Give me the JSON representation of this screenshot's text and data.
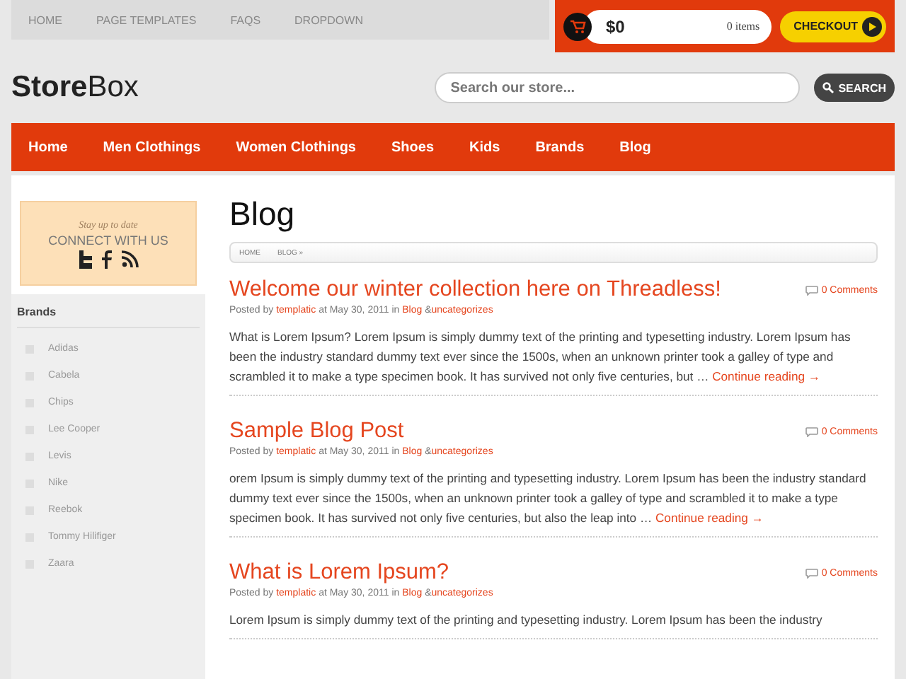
{
  "top_menu": [
    "HOME",
    "PAGE TEMPLATES",
    "FAQS",
    "DROPDOWN"
  ],
  "cart": {
    "total": "$0",
    "items": "0 items",
    "checkout": "CHECKOUT"
  },
  "logo": "**Store**Box",
  "search": {
    "placeholder": "Search our store...",
    "button": "SEARCH"
  },
  "nav": [
    "Home",
    "Men Clothings",
    "Women Clothings",
    "Shoes",
    "Kids",
    "Brands",
    "Blog"
  ],
  "connect": {
    "tagline": "Stay up to date",
    "title": "CONNECT WITH US"
  },
  "brands": {
    "title": "Brands",
    "items": [
      "Adidas",
      "Cabela",
      "Chips",
      "Lee Cooper",
      "Levis",
      "Nike",
      "Reebok",
      "Tommy Hilifiger",
      "Zaara"
    ]
  },
  "page_title": "Blog",
  "breadcrumb": [
    "HOME",
    "BLOG »"
  ],
  "posts": [
    {
      "title": "Welcome our winter collection here on Threadless!",
      "comments": "0 Comments",
      "by": "Posted by",
      "author": "templatic",
      "date": "at May 30, 2011 in",
      "category": "Blog",
      "amp": "&",
      "tag": "uncategorizes",
      "excerpt": "What is Lorem Ipsum? Lorem Ipsum is simply dummy text of the printing and typesetting industry. Lorem Ipsum has been the industry standard dummy text ever since the 1500s, when an unknown printer took a galley of type and scrambled it to make a type specimen book. It has survived not only five centuries, but …",
      "more": "Continue reading →"
    },
    {
      "title": "Sample Blog Post",
      "comments": "0 Comments",
      "by": "Posted by",
      "author": "templatic",
      "date": "at May 30, 2011 in",
      "category": "Blog",
      "amp": "&",
      "tag": "uncategorizes",
      "excerpt": "orem Ipsum is simply dummy text of the printing and typesetting industry. Lorem Ipsum has been the industry standard dummy text ever since the 1500s, when an unknown printer took a galley of type and scrambled it to make a type specimen book. It has survived not only five centuries, but also the leap into …",
      "more": "Continue reading →"
    },
    {
      "title": "What is Lorem Ipsum?",
      "comments": "0 Comments",
      "by": "Posted by",
      "author": "templatic",
      "date": "at May 30, 2011 in",
      "category": "Blog",
      "amp": "&",
      "tag": "uncategorizes",
      "excerpt": "Lorem Ipsum is simply dummy text of the printing and typesetting industry. Lorem Ipsum has been the industry"
    }
  ]
}
